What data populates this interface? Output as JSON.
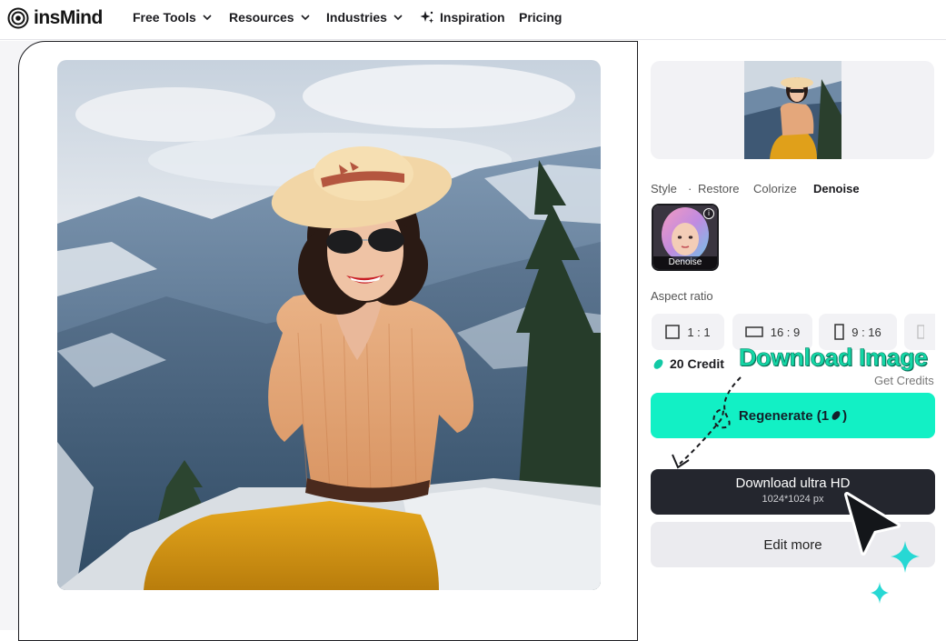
{
  "brand": {
    "name": "insMind"
  },
  "nav": {
    "items": [
      {
        "label": "Free Tools",
        "dropdown": true
      },
      {
        "label": "Resources",
        "dropdown": true
      },
      {
        "label": "Industries",
        "dropdown": true
      },
      {
        "label": "Inspiration",
        "dropdown": false,
        "icon": "sparkle-icon"
      },
      {
        "label": "Pricing",
        "dropdown": false
      }
    ]
  },
  "panel": {
    "tabs": [
      {
        "label": "Style",
        "active": false
      },
      {
        "label": "Restore",
        "active": false
      },
      {
        "label": "Colorize",
        "active": false
      },
      {
        "label": "Denoise",
        "active": true
      }
    ],
    "style_card_label": "Denoise",
    "aspect_title": "Aspect ratio",
    "ratios": [
      "1 : 1",
      "16 : 9",
      "9 : 16"
    ],
    "credit": "20 Credit",
    "get_credits": "Get Credits",
    "regenerate_label": "Regenerate (1",
    "regenerate_suffix": ")",
    "download_label": "Download ultra HD",
    "download_size": "1024*1024 px",
    "edit_label": "Edit more"
  },
  "annotation": {
    "text": "Download Image"
  },
  "colors": {
    "accent": "#12f0c5",
    "dark_button": "#24262e",
    "annotation": "#14d7a6"
  }
}
